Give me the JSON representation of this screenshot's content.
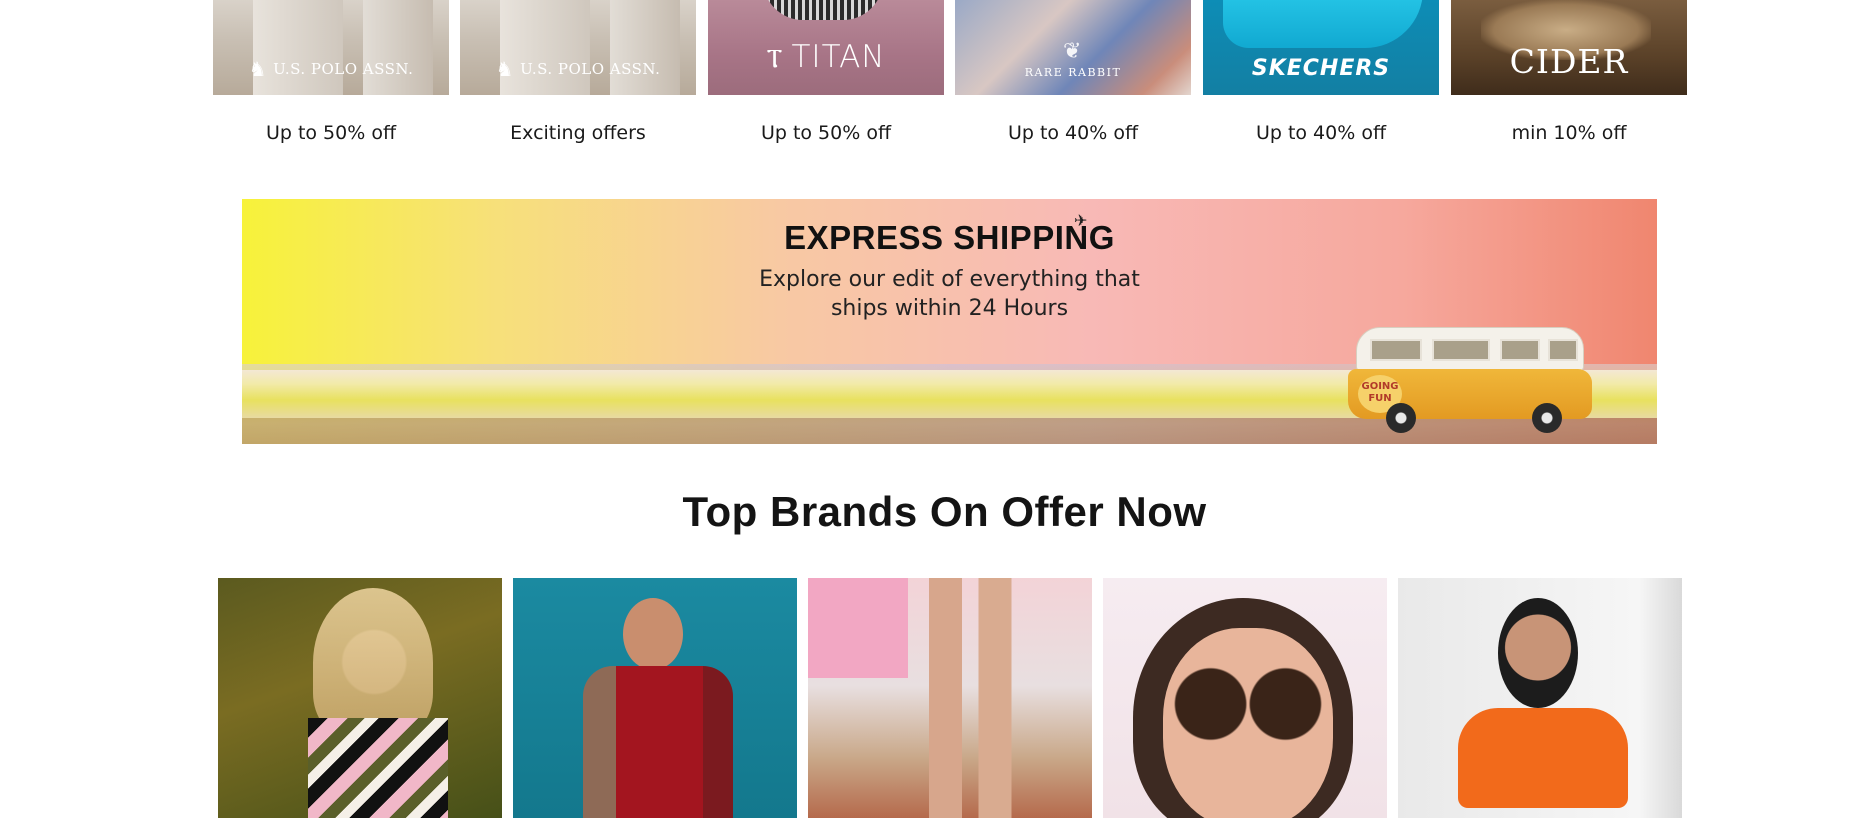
{
  "brands": [
    {
      "logo": "U.S. POLO ASSN.",
      "offer": "Up to 50% off"
    },
    {
      "logo": "U.S. POLO ASSN.",
      "offer": "Exciting offers"
    },
    {
      "logo": "TITAN",
      "offer": "Up to 50% off"
    },
    {
      "logo": "RARE RABBIT",
      "offer": "Up to 40% off"
    },
    {
      "logo": "SKECHERS",
      "offer": "Up to 40% off"
    },
    {
      "logo": "CIDER",
      "offer": "min 10% off"
    }
  ],
  "banner": {
    "title": "EXPRESS SHIPPING",
    "subtitle_line1": "Explore our edit of everything that",
    "subtitle_line2": "ships within 24 Hours",
    "van_badge": "GOING FUN"
  },
  "section": {
    "title": "Top Brands On Offer Now"
  },
  "colors": {
    "banner_gradient_start": "#f7f23a",
    "banner_gradient_end": "#f0866f",
    "skechers_blue": "#11a9d1",
    "titan_pink": "#b98a99"
  }
}
